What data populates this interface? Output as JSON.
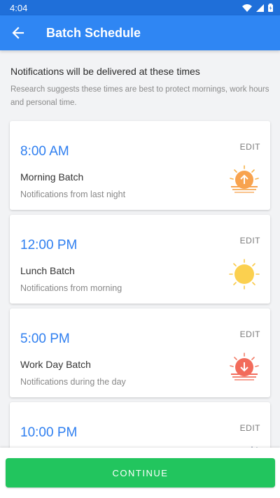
{
  "status_bar": {
    "time": "4:04"
  },
  "app_bar": {
    "title": "Batch Schedule",
    "back_icon": "arrow-left-icon"
  },
  "intro": {
    "heading": "Notifications will be delivered at these times",
    "subtext": "Research suggests these times are best to protect mornings, work hours and personal time."
  },
  "batches": [
    {
      "time": "8:00 AM",
      "edit_label": "EDIT",
      "name": "Morning Batch",
      "description": "Notifications from last night",
      "icon": "sunrise-icon"
    },
    {
      "time": "12:00 PM",
      "edit_label": "EDIT",
      "name": "Lunch Batch",
      "description": "Notifications from morning",
      "icon": "sun-icon"
    },
    {
      "time": "5:00 PM",
      "edit_label": "EDIT",
      "name": "Work Day Batch",
      "description": "Notifications during the day",
      "icon": "sunset-icon"
    },
    {
      "time": "10:00 PM",
      "edit_label": "EDIT",
      "name": "",
      "description": "",
      "icon": "moon-icon"
    }
  ],
  "footer": {
    "continue_label": "CONTINUE"
  },
  "colors": {
    "app_bar": "#2f86f3",
    "status_bar": "#1f6fd9",
    "accent_time": "#2f7ff0",
    "continue": "#22c55e"
  }
}
